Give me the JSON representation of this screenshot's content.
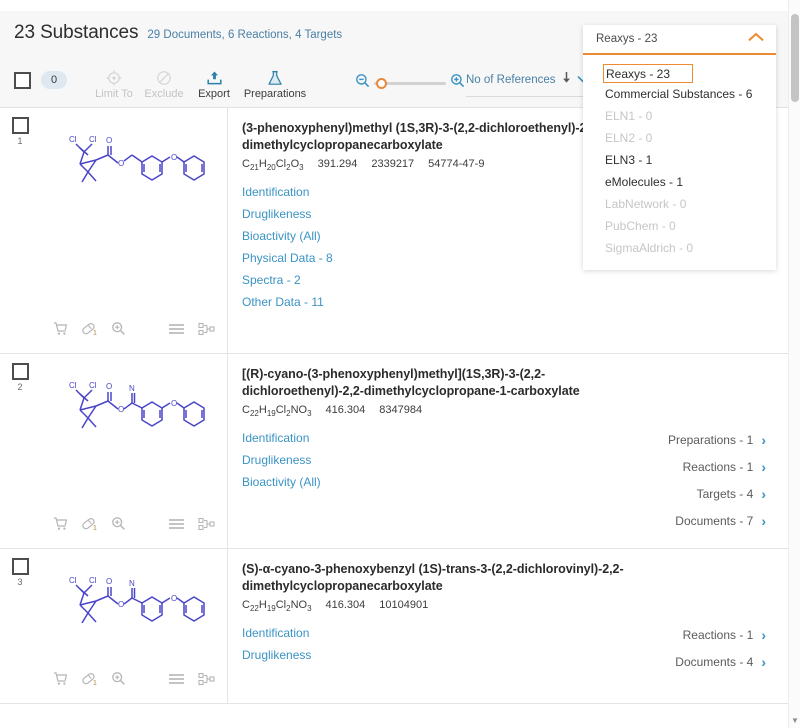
{
  "header": {
    "title": "23 Substances",
    "subtitle": "29 Documents, 6 Reactions, 4 Targets"
  },
  "toolbar": {
    "selected_count": "0",
    "buttons": [
      {
        "label": "Limit To",
        "icon": "limit-to-icon",
        "enabled": false
      },
      {
        "label": "Exclude",
        "icon": "exclude-icon",
        "enabled": false
      },
      {
        "label": "Export",
        "icon": "export-icon",
        "enabled": true
      },
      {
        "label": "Preparations",
        "icon": "preparations-icon",
        "enabled": true
      }
    ],
    "zoom_out_icon": "zoom-out-icon",
    "zoom_in_icon": "zoom-in-icon",
    "sort_label": "No of References",
    "sort_direction_icon": "sort-descending-icon",
    "sort_dropdown_icon": "chevron-down-icon"
  },
  "source_dropdown": {
    "selected_label": "Reaxys - 23",
    "toggle_icon": "chevron-up-icon",
    "accent_color": "#ec8b32",
    "options": [
      {
        "label": "Reaxys - 23",
        "enabled": true,
        "selected": true
      },
      {
        "label": "Commercial Substances - 6",
        "enabled": true,
        "selected": false
      },
      {
        "label": "ELN1 - 0",
        "enabled": false,
        "selected": false
      },
      {
        "label": "ELN2 - 0",
        "enabled": false,
        "selected": false
      },
      {
        "label": "ELN3 - 1",
        "enabled": true,
        "selected": false
      },
      {
        "label": "eMolecules - 1",
        "enabled": true,
        "selected": false
      },
      {
        "label": "LabNetwork - 0",
        "enabled": false,
        "selected": false
      },
      {
        "label": "PubChem - 0",
        "enabled": false,
        "selected": false
      },
      {
        "label": "SigmaAldrich - 0",
        "enabled": false,
        "selected": false
      }
    ]
  },
  "structure_actions": [
    {
      "icon": "cart-icon",
      "label": ""
    },
    {
      "icon": "capsule-icon",
      "label": "1"
    },
    {
      "icon": "magnifier-icon",
      "label": ""
    },
    {
      "icon": "list-icon",
      "label": ""
    },
    {
      "icon": "tree-icon",
      "label": ""
    }
  ],
  "results": [
    {
      "number": "1",
      "name": "(3-phenoxyphenyl)methyl (1S,3R)-3-(2,2-dichloroethenyl)-2,2-dimethylcyclopropanecarboxylate",
      "formula_html": "C<sub>21</sub>H<sub>20</sub>Cl<sub>2</sub>O<sub>3</sub>",
      "molecular_weight": "391.294",
      "registry_number": "2339217",
      "cas_number": "54774-47-9",
      "links": [
        "Identification",
        "Druglikeness",
        "Bioactivity (All)",
        "Physical Data - 8",
        "Spectra - 2",
        "Other Data - 11"
      ],
      "side_links": []
    },
    {
      "number": "2",
      "name": "[(R)-cyano-(3-phenoxyphenyl)methyl](1S,3R)-3-(2,2-dichloroethenyl)-2,2-dimethylcyclopropane-1-carboxylate",
      "formula_html": "C<sub>22</sub>H<sub>19</sub>Cl<sub>2</sub>NO<sub>3</sub>",
      "molecular_weight": "416.304",
      "registry_number": "8347984",
      "cas_number": "",
      "links": [
        "Identification",
        "Druglikeness",
        "Bioactivity (All)"
      ],
      "side_links": [
        "Preparations - 1",
        "Reactions - 1",
        "Targets - 4",
        "Documents - 7"
      ]
    },
    {
      "number": "3",
      "name": "(S)-α-cyano-3-phenoxybenzyl (1S)-trans-3-(2,2-dichlorovinyl)-2,2-dimethylcyclopropanecarboxylate",
      "formula_html": "C<sub>22</sub>H<sub>19</sub>Cl<sub>2</sub>NO<sub>3</sub>",
      "molecular_weight": "416.304",
      "registry_number": "10104901",
      "cas_number": "",
      "links": [
        "Identification",
        "Druglikeness"
      ],
      "side_links": [
        "Reactions - 1",
        "Documents - 4"
      ]
    }
  ],
  "scrollbar": {
    "down_arrow_icon": "scroll-down-arrow-icon"
  }
}
